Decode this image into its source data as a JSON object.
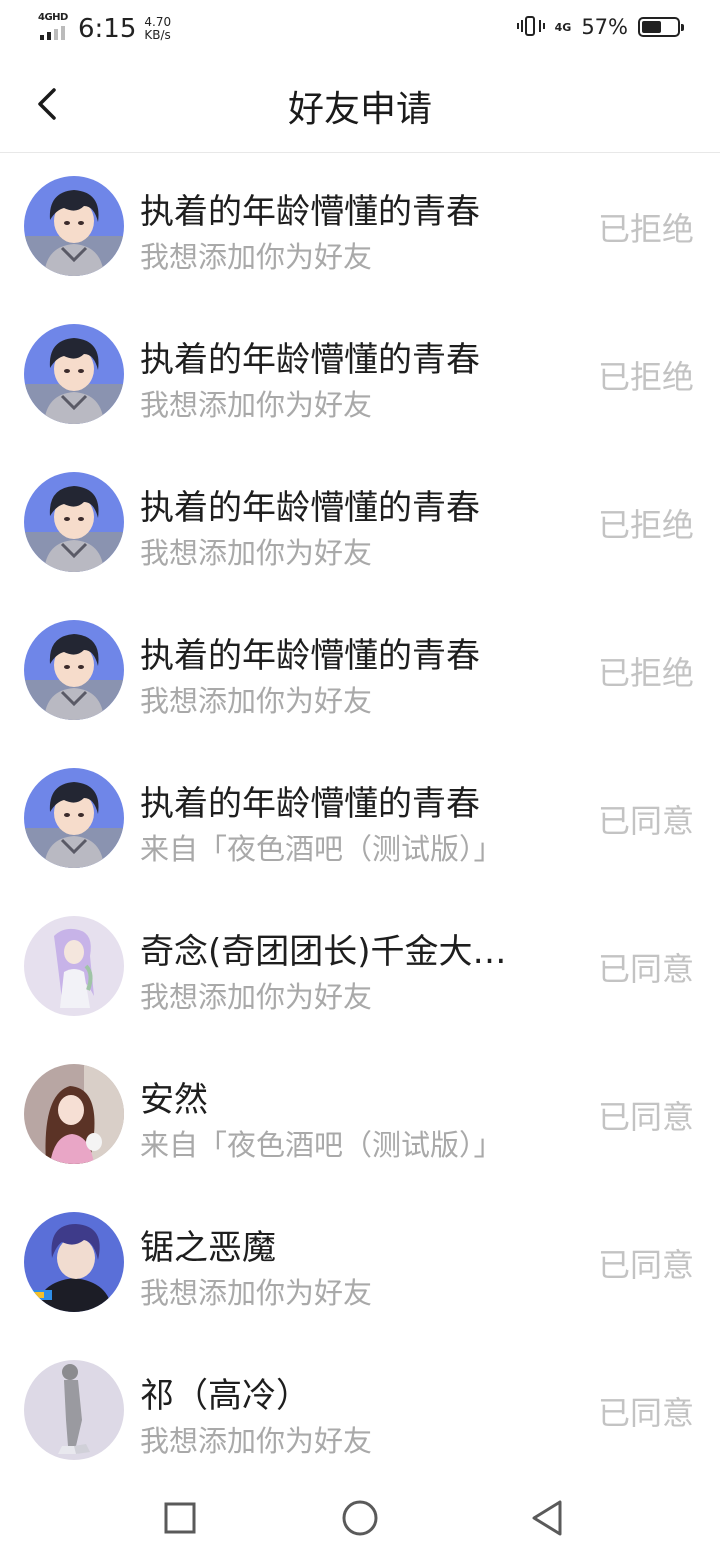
{
  "status_bar": {
    "network_tag": "4GHD",
    "time": "6:15",
    "speed_value": "4.70",
    "speed_unit": "KB/s",
    "network_right": "4G",
    "battery_percent": "57%",
    "battery_level": 0.57
  },
  "header": {
    "title": "好友申请",
    "back_icon": "chevron-left-icon"
  },
  "requests": [
    {
      "name": "执着的年龄懵懂的青春",
      "message": "我想添加你为好友",
      "status": "已拒绝"
    },
    {
      "name": "执着的年龄懵懂的青春",
      "message": "我想添加你为好友",
      "status": "已拒绝"
    },
    {
      "name": "执着的年龄懵懂的青春",
      "message": "我想添加你为好友",
      "status": "已拒绝"
    },
    {
      "name": "执着的年龄懵懂的青春",
      "message": "我想添加你为好友",
      "status": "已拒绝"
    },
    {
      "name": "执着的年龄懵懂的青春",
      "message": "来自「夜色酒吧（测试版）」",
      "status": "已同意"
    },
    {
      "name": "奇念(奇团团长)千金大…",
      "message": "我想添加你为好友",
      "status": "已同意"
    },
    {
      "name": "安然",
      "message": "来自「夜色酒吧（测试版）」",
      "status": "已同意"
    },
    {
      "name": "锯之恶魔",
      "message": "我想添加你为好友",
      "status": "已同意"
    },
    {
      "name": "祁（高冷）",
      "message": "我想添加你为好友",
      "status": "已同意"
    }
  ],
  "nav_bar": {
    "recent_icon": "square-icon",
    "home_icon": "circle-icon",
    "back_icon": "triangle-back-icon"
  },
  "colors": {
    "name_text": "#1e1e1e",
    "message_text": "#a9a9a9",
    "status_text": "#c3c3c3",
    "avatar_blue": "#6f86e8"
  }
}
